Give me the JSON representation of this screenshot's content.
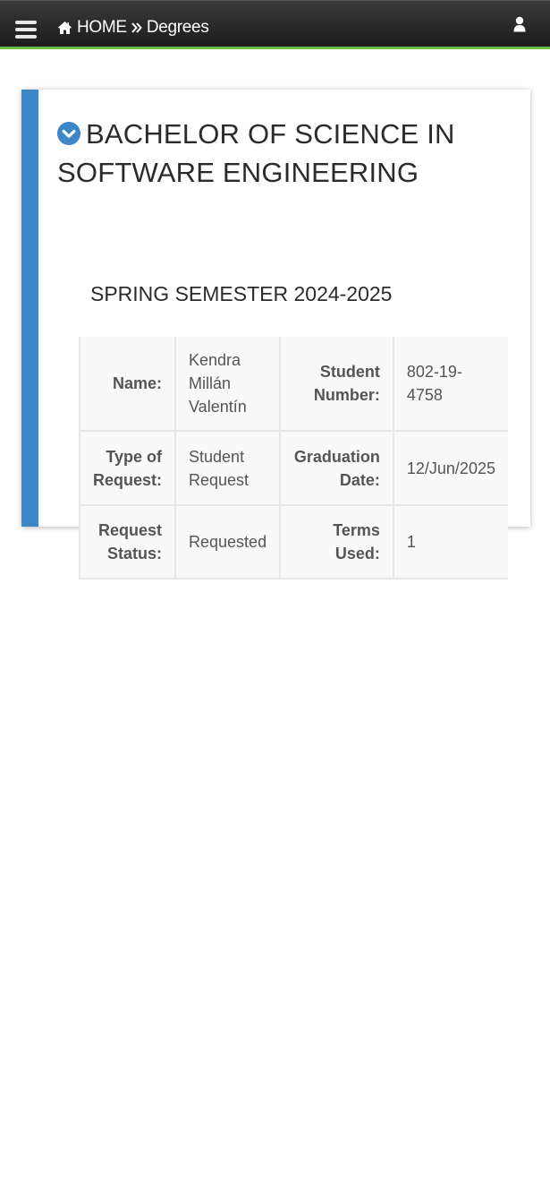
{
  "header": {
    "breadcrumb_home": "HOME",
    "breadcrumb_current": "Degrees",
    "accent_color": "#6cbe45",
    "icons": [
      "menu-icon",
      "home-icon",
      "double-chevron-right-icon",
      "user-icon"
    ]
  },
  "degree": {
    "title": "BACHELOR OF SCIENCE IN SOFTWARE ENGINEERING",
    "semester": "SPRING SEMESTER 2024-2025",
    "accent_color": "#3d87c9",
    "icon": "chevron-circle-down-icon"
  },
  "details": {
    "name_label": "Name:",
    "name_value": "Kendra Millán Valentín",
    "student_number_label": "Student Number:",
    "student_number_value": "802-19-4758",
    "type_label": "Type of Request:",
    "type_value": "Student Request",
    "graduation_label": "Graduation Date:",
    "graduation_value": "12/Jun/2025",
    "status_label": "Request Status:",
    "status_value": "Requested",
    "terms_label": "Terms Used:",
    "terms_value": "1"
  }
}
